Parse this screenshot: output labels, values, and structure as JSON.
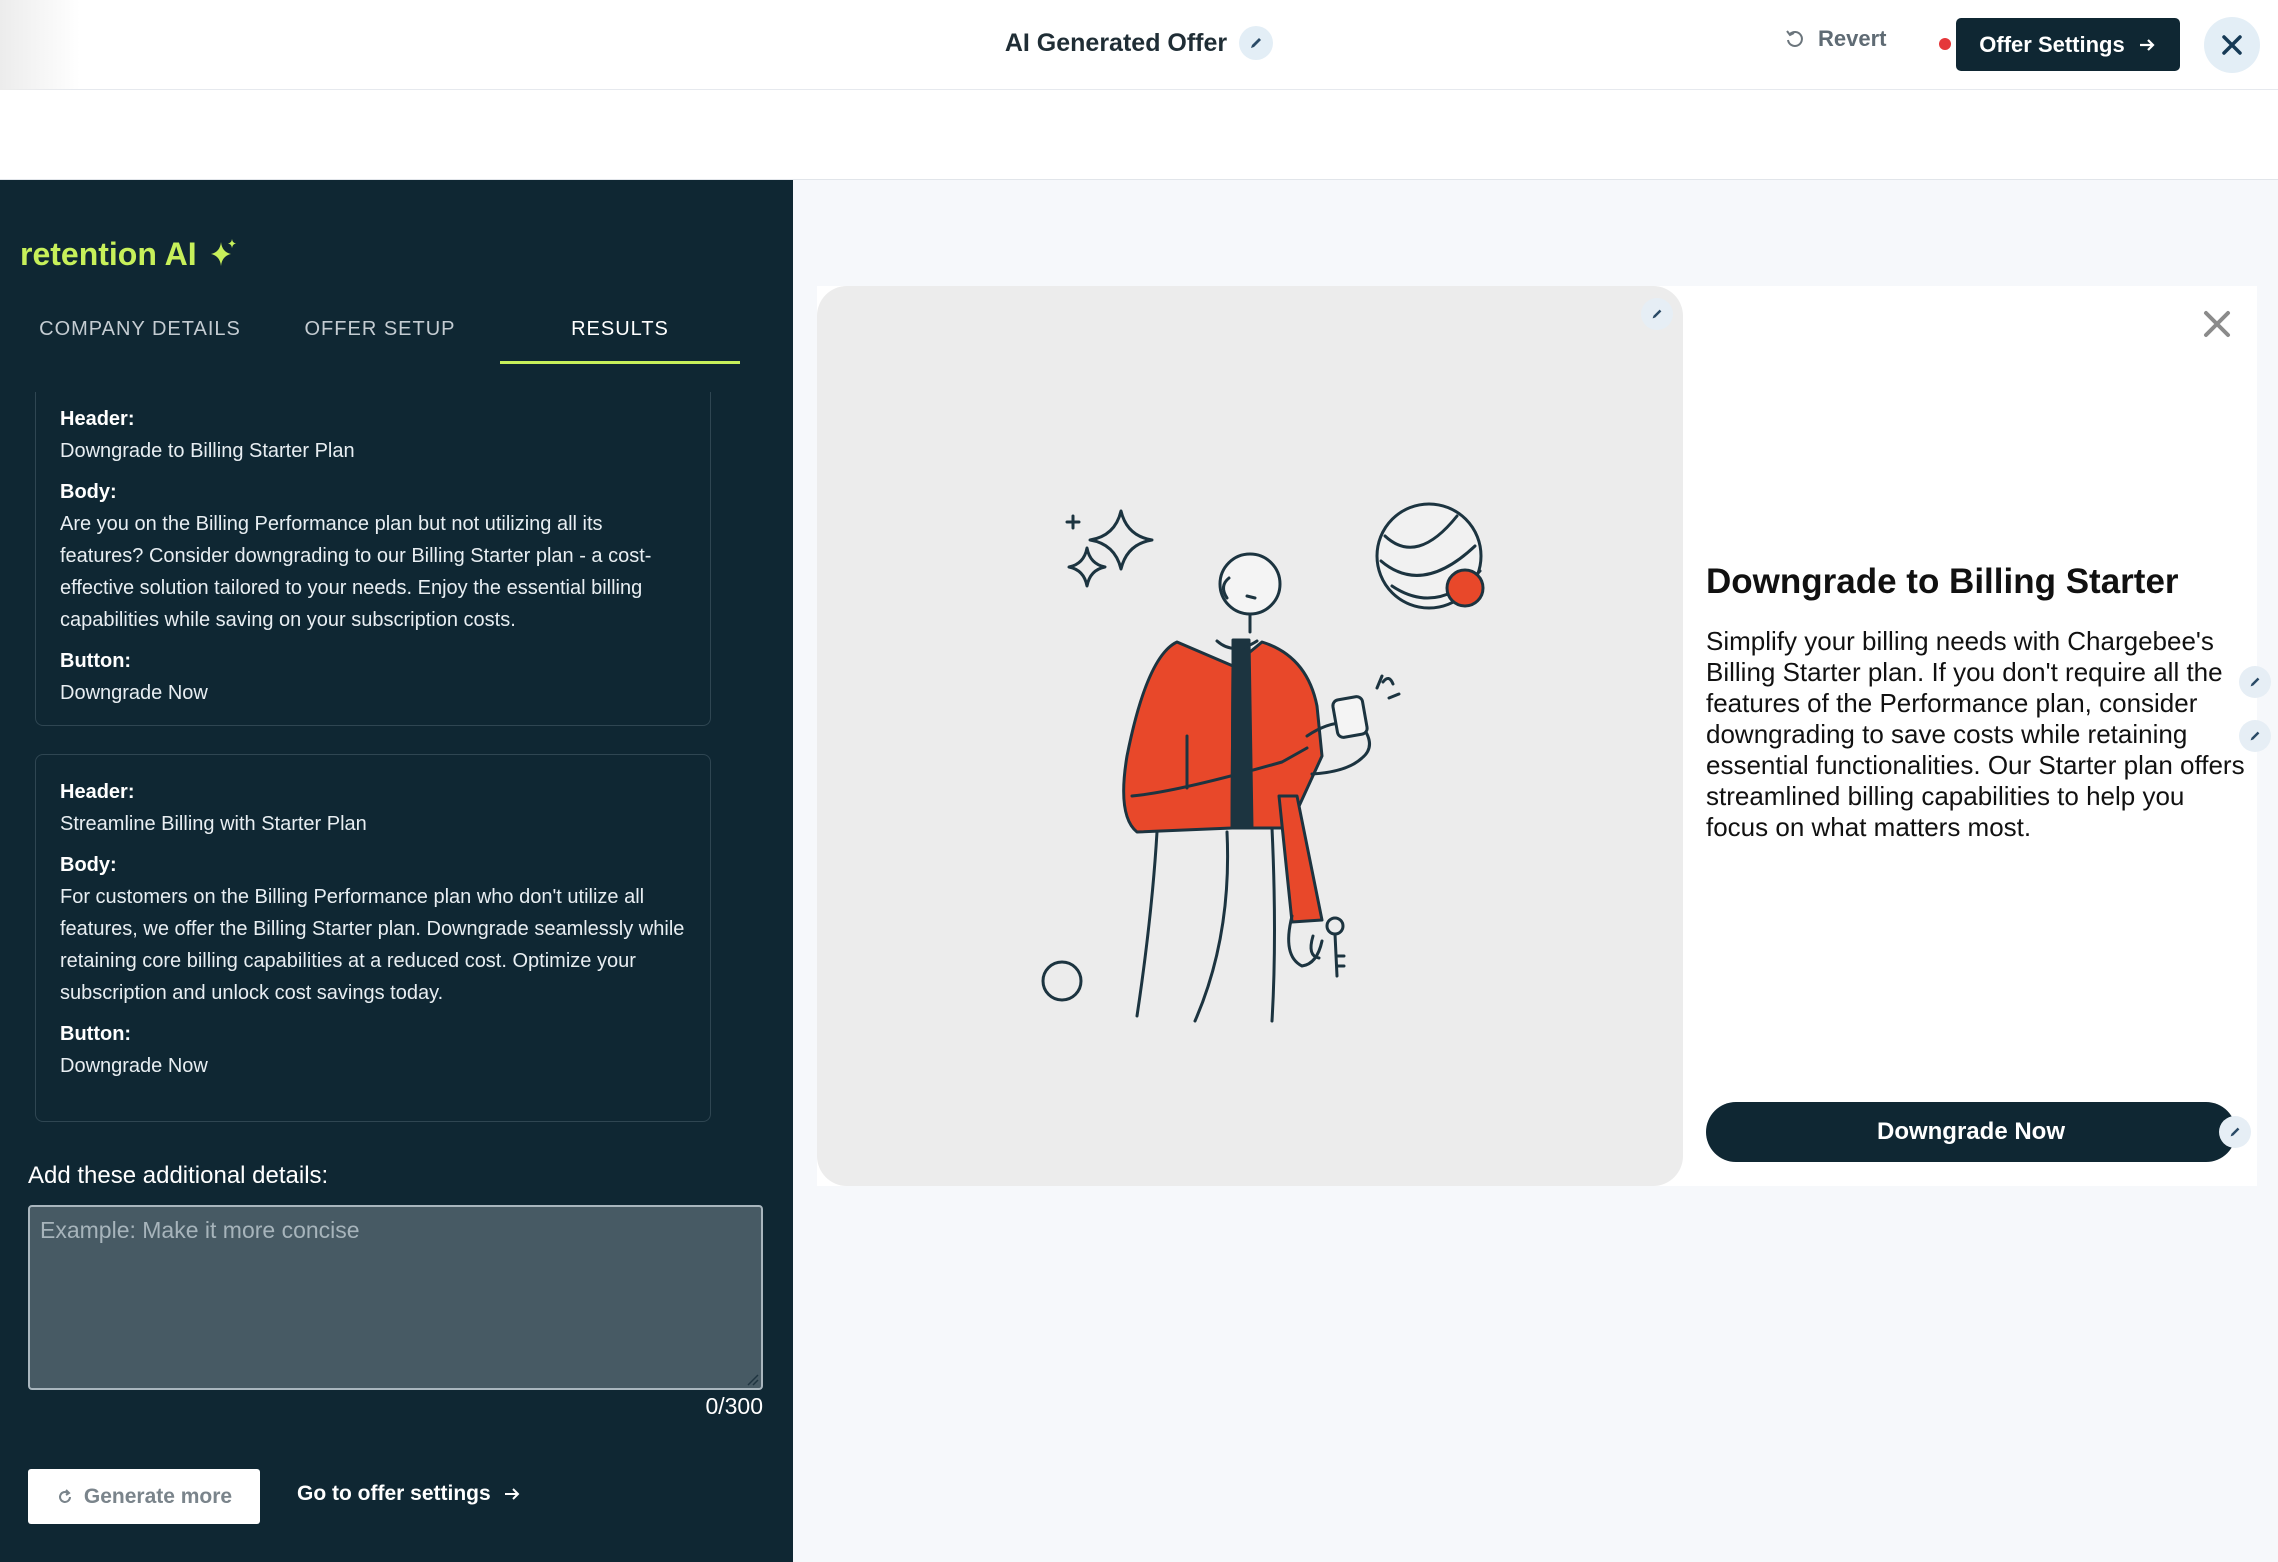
{
  "header": {
    "title": "AI Generated Offer",
    "revert_label": "Revert",
    "offer_settings_label": "Offer Settings"
  },
  "sidebar": {
    "brand": "retention AI",
    "tabs": [
      {
        "label": "COMPANY DETAILS",
        "active": false
      },
      {
        "label": "OFFER SETUP",
        "active": false
      },
      {
        "label": "RESULTS",
        "active": true
      }
    ],
    "results": [
      {
        "header_label": "Header:",
        "header_value": "Downgrade to Billing Starter Plan",
        "body_label": "Body:",
        "body_value": "Are you on the Billing Performance plan but not utilizing all its features? Consider downgrading to our Billing Starter plan - a cost-effective solution tailored to your needs. Enjoy the essential billing capabilities while saving on your subscription costs.",
        "button_label": "Button:",
        "button_value": "Downgrade Now"
      },
      {
        "header_label": "Header:",
        "header_value": "Streamline Billing with Starter Plan",
        "body_label": "Body:",
        "body_value": "For customers on the Billing Performance plan who don't utilize all features, we offer the Billing Starter plan. Downgrade seamlessly while retaining core billing capabilities at a reduced cost. Optimize your subscription and unlock cost savings today.",
        "button_label": "Button:",
        "button_value": "Downgrade Now"
      }
    ],
    "additional_details_label": "Add these additional details:",
    "additional_details_placeholder": "Example: Make it more concise",
    "char_count": "0/300",
    "generate_more_label": "Generate more",
    "go_to_settings_label": "Go to offer settings"
  },
  "preview": {
    "title": "Downgrade to Billing Starter",
    "body": "Simplify your billing needs with Chargebee's Billing Starter plan. If you don't require all the features of the Performance plan, consider downgrading to save costs while retaining essential functionalities. Our Starter plan offers streamlined billing capabilities to help you focus on what matters most.",
    "cta_label": "Downgrade Now"
  },
  "colors": {
    "sidebar_bg": "#0f2733",
    "accent": "#c7f05a",
    "illustration_red": "#e8482a",
    "status_dot": "#e5373a"
  }
}
